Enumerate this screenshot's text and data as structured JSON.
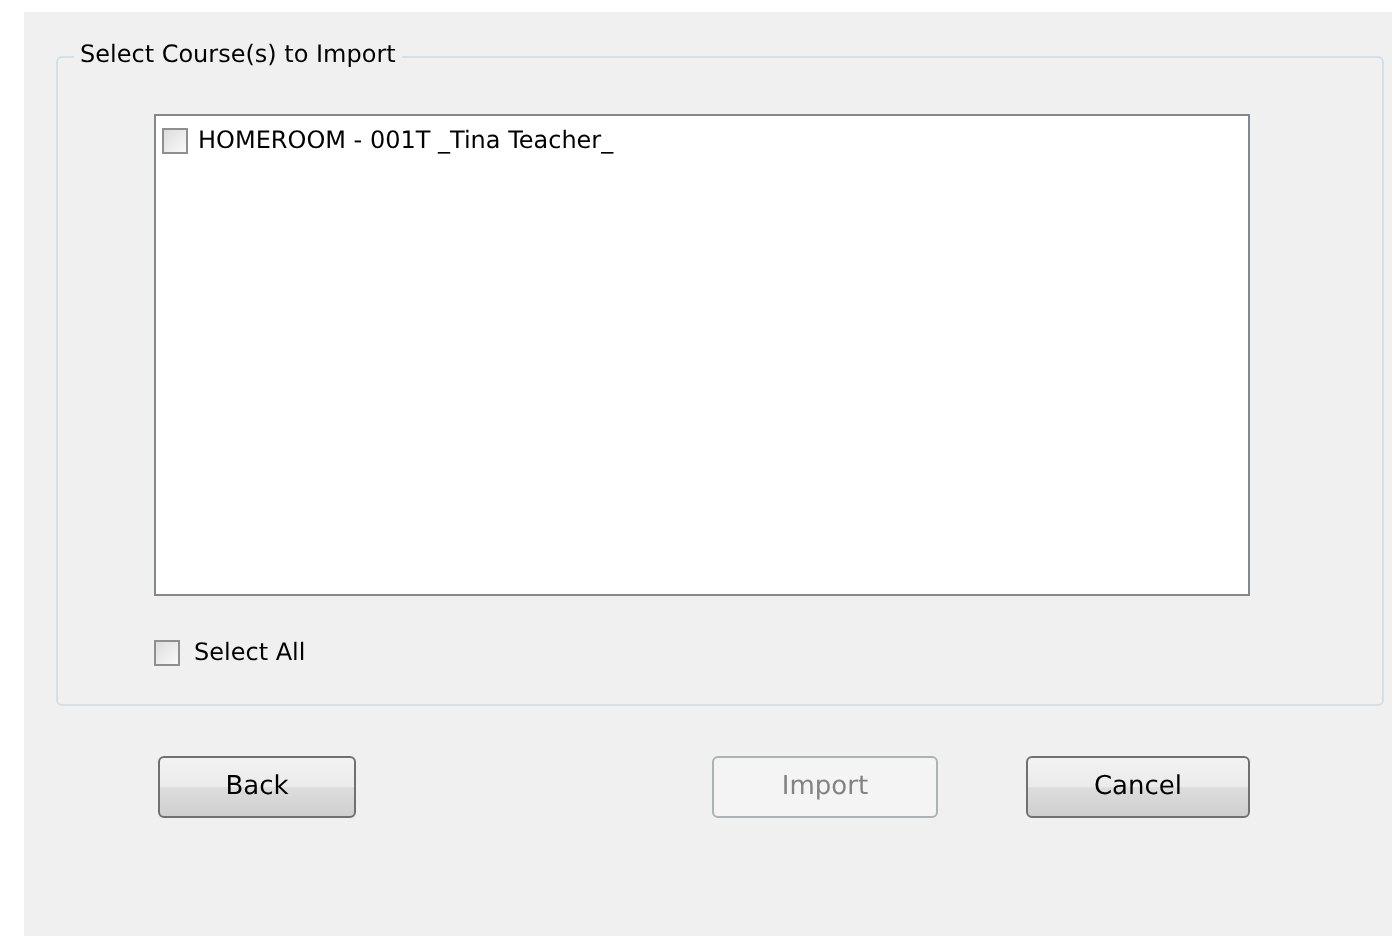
{
  "group": {
    "title": "Select Course(s) to Import"
  },
  "courses": [
    {
      "label": "HOMEROOM - 001T _Tina Teacher_",
      "checked": false
    }
  ],
  "select_all": {
    "label": "Select All",
    "checked": false
  },
  "buttons": [
    {
      "label": "Back",
      "disabled": false
    },
    {
      "label": "Import",
      "disabled": true
    },
    {
      "label": "Cancel",
      "disabled": false
    }
  ]
}
